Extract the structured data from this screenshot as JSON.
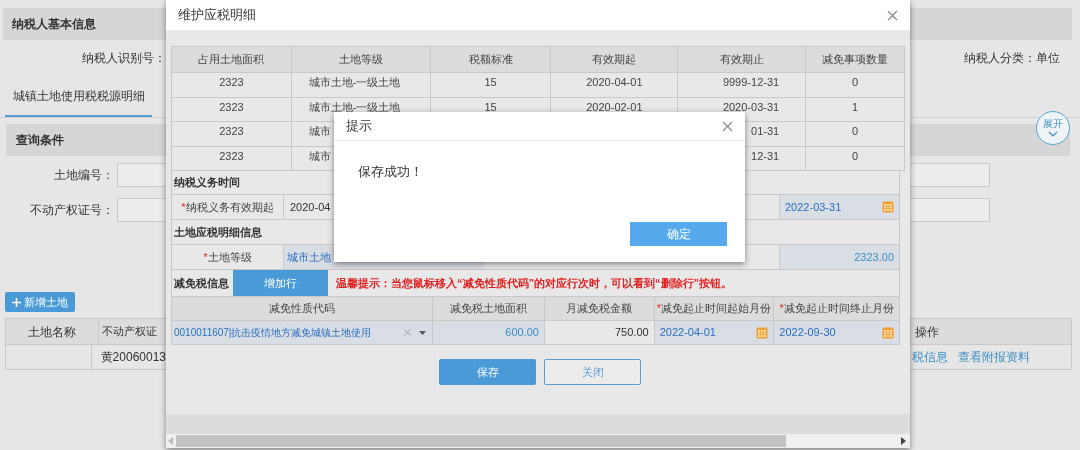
{
  "page": {
    "header": "纳税人基本信息",
    "taxpayer_id_label": "纳税人识别号：",
    "taxpayer_type": "纳税人分类：单位",
    "tab": "城镇土地使用税税源明细",
    "query_title": "查询条件",
    "expand_button": "展开",
    "fields": [
      {
        "label": "土地编号："
      },
      {
        "label": "不动产权证号："
      }
    ],
    "add_button": "新增土地",
    "table": {
      "columns": [
        "土地名称",
        "不动产权证"
      ],
      "action_column": "操作",
      "rows": [
        {
          "cert_no": "黄20060013",
          "actions": [
            "税信息",
            "查看附报资料"
          ]
        }
      ]
    }
  },
  "modal": {
    "title": "维护应税明细",
    "table": {
      "columns": [
        "占用土地面积",
        "土地等级",
        "税额标准",
        "有效期起",
        "有效期止",
        "减免事项数量"
      ],
      "rows": [
        {
          "area": "2323",
          "grade": "城市土地-一级土地",
          "rate": "15",
          "start": "2020-04-01",
          "end": "9999-12-31",
          "count": "0"
        },
        {
          "area": "2323",
          "grade": "城市土地-一级土地",
          "rate": "15",
          "start": "2020-02-01",
          "end": "2020-03-31",
          "count": "1"
        },
        {
          "area": "2323",
          "grade": "城市",
          "end": "01-31",
          "count": "0"
        },
        {
          "area": "2323",
          "grade": "城市",
          "end": "12-31",
          "count": "0"
        }
      ]
    },
    "duty_section": {
      "title": "纳税义务时间",
      "marker": "*",
      "label": "纳税义务有效期起",
      "value": "2020-04",
      "end_value": "2022-03-31"
    },
    "detail_section": {
      "title": "土地应税明细信息",
      "marker": "*",
      "label": "土地等级",
      "value": "城市土地",
      "area_value": "2323.00"
    },
    "relief": {
      "title": "减免税信息",
      "add_row_button": "增加行",
      "hint": "温馨提示：当您鼠标移入“减免性质代码”的对应行次时，可以看到“删除行”按钮。",
      "columns": [
        {
          "label": "减免性质代码"
        },
        {
          "label": "减免税土地面积"
        },
        {
          "label": "月减免税金额"
        },
        {
          "marker": "*",
          "label": "减免起止时间起始月份"
        },
        {
          "marker": "*",
          "label": "减免起止时间终止月份"
        }
      ],
      "rows": [
        {
          "code": "0010011607|抗击疫情地方减免城镇土地使用",
          "area": "600.00",
          "amount": "750.00",
          "start": "2022-04-01",
          "end": "2022-09-30"
        }
      ]
    },
    "buttons": [
      {
        "label": "保存",
        "kind": "primary"
      },
      {
        "label": "关闭",
        "kind": "secondary"
      }
    ]
  },
  "alert": {
    "title": "提示",
    "message": "保存成功！",
    "button": "确定"
  }
}
